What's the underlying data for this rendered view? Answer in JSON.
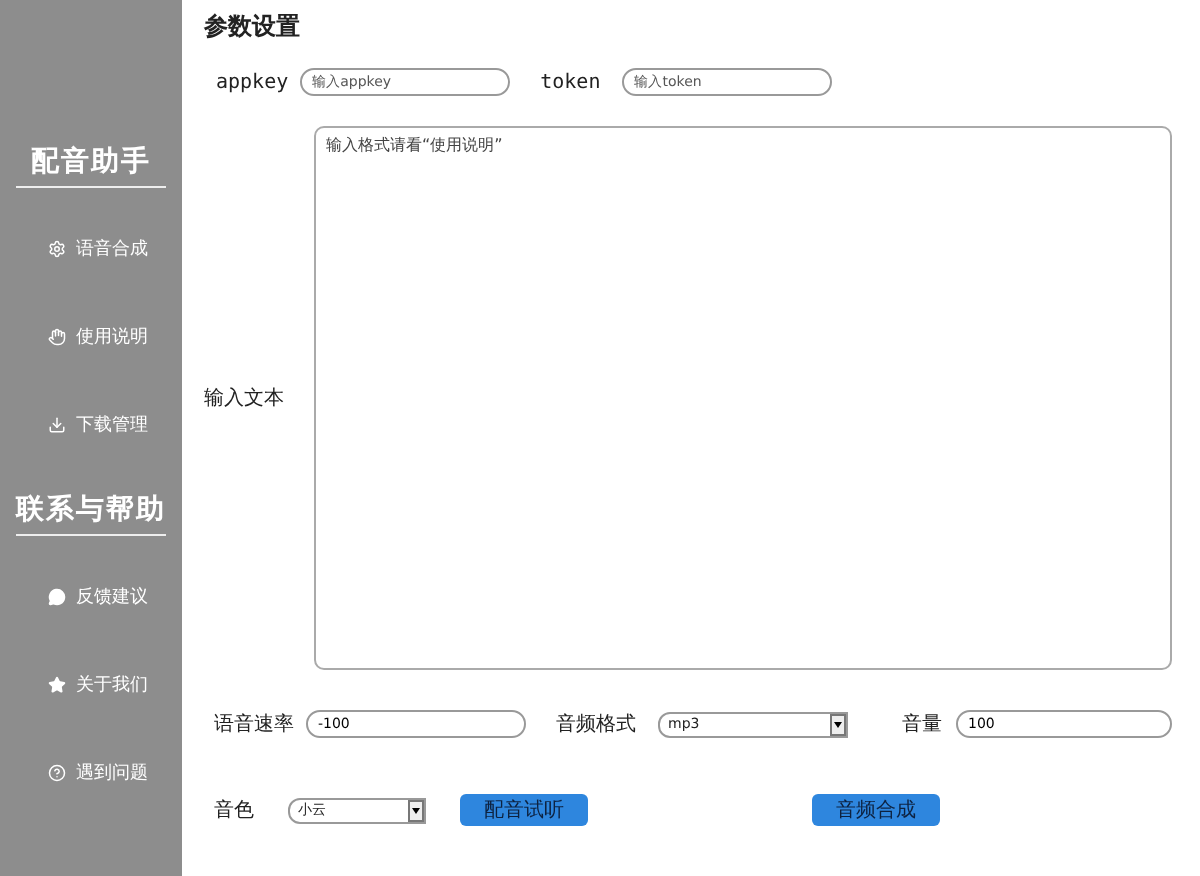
{
  "sidebar": {
    "sections": [
      {
        "title": "配音助手",
        "items": [
          {
            "kind": "gear",
            "label": "语音合成"
          },
          {
            "kind": "hand",
            "label": "使用说明"
          },
          {
            "kind": "download",
            "label": "下载管理"
          }
        ]
      },
      {
        "title": "联系与帮助",
        "items": [
          {
            "kind": "chat",
            "label": "反馈建议"
          },
          {
            "kind": "star",
            "label": "关于我们"
          },
          {
            "kind": "help",
            "label": "遇到问题"
          }
        ]
      }
    ]
  },
  "panel": {
    "title": "参数设置",
    "appkey": {
      "label": "appkey",
      "placeholder": "输入appkey"
    },
    "token": {
      "label": "token",
      "placeholder": "输入token"
    },
    "text_input": {
      "label": "输入文本",
      "placeholder": "输入格式请看“使用说明”"
    },
    "speech_rate": {
      "label": "语音速率",
      "value": "-100"
    },
    "audio_format": {
      "label": "音频格式",
      "value": "mp3"
    },
    "volume": {
      "label": "音量",
      "value": "100"
    },
    "voice": {
      "label": "音色",
      "value": "小云"
    },
    "buttons": [
      {
        "label": "配音试听"
      },
      {
        "label": "音频合成"
      }
    ]
  }
}
